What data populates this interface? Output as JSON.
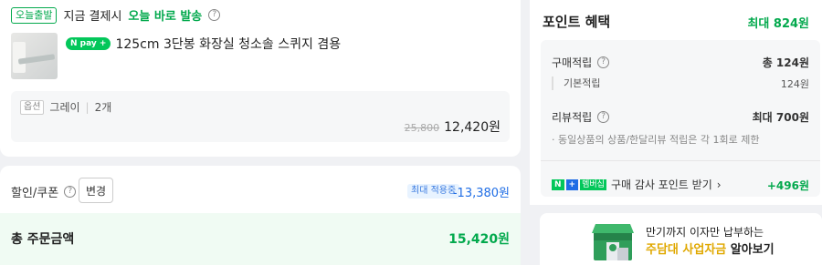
{
  "product": {
    "badge": "오늘출발",
    "ship_prefix": "지금 결제시",
    "ship_highlight": "오늘 바로 발송",
    "pay_badge": "N pay +",
    "title": "125cm 3단봉 화장실 청소솔 스퀴지 겸용",
    "option_tag": "옵션",
    "option_value": "그레이",
    "quantity": "2개",
    "original_price": "25,800",
    "price": "12,420원"
  },
  "discount": {
    "label": "할인/쿠폰",
    "change_button": "변경",
    "max_badge": "최대 적용중",
    "amount": "-13,380원"
  },
  "total": {
    "label": "총 주문금액",
    "amount": "15,420원"
  },
  "points": {
    "title": "포인트 혜택",
    "max": "최대 824원",
    "purchase_label": "구매적립",
    "purchase_value": "총 124원",
    "basic_label": "기본적립",
    "basic_value": "124원",
    "review_label": "리뷰적립",
    "review_value": "최대 700원",
    "review_note": "· 동일상품의 상품/한달리뷰 적립은 각 1회로 제한",
    "membership_badge_n": "N",
    "membership_badge_plus": "+",
    "membership_badge_text": "멤버십",
    "review_cta": "구매 감사 포인트 받기",
    "review_cta_value": "+496원"
  },
  "banner": {
    "line1": "만기까지 이자만 납부하는",
    "line2_highlight": "주담대 사업자금",
    "line2_rest": " 알아보기"
  },
  "colors": {
    "green": "#03a94d",
    "blue": "#1f6de5",
    "npay_green": "#03c75a"
  }
}
